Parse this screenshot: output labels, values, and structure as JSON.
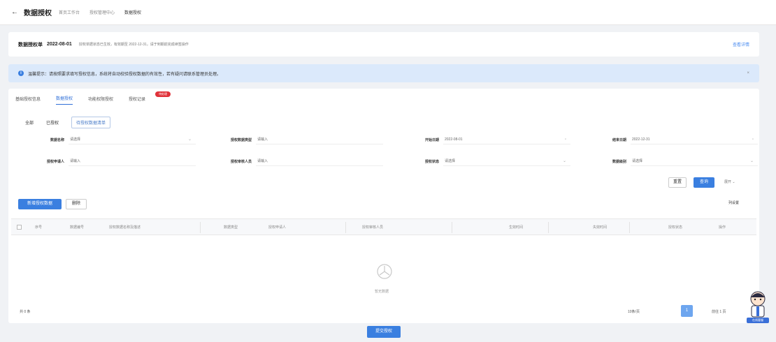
{
  "header": {
    "back_icon": "arrow-left-icon",
    "title": "数据授权",
    "breadcrumbs": [
      "首页工作台",
      "授权管理中心",
      "数据授权"
    ]
  },
  "info": {
    "label": "数据授权单",
    "date": "2022-08-01",
    "desc": "授权单据状态已生效，有效期至 2022-12-31，请于到期前完成续签操作",
    "link": "查看详情"
  },
  "notice": {
    "icon": "info-icon",
    "text": "温馨提示：请按照要求填写授权信息，系统将自动校验授权数据的有效性，若有疑问请联系管理员处理。",
    "close": "×"
  },
  "tabs": [
    {
      "label": "基础授权信息"
    },
    {
      "label": "数据授权"
    },
    {
      "label": "功能权限授权"
    },
    {
      "label": "授权记录"
    }
  ],
  "tab_badge": "待处理",
  "subtabs": [
    "全部",
    "已授权",
    "待授权数据清单"
  ],
  "filters_row1": [
    {
      "label": "数据名称",
      "value": "请选择",
      "icon": "chevron-down-icon"
    },
    {
      "label": "授权数据类型",
      "value": "请输入",
      "icon": ""
    },
    {
      "label": "开始日期",
      "value": "2022-08-01",
      "icon": "calendar-icon"
    },
    {
      "label": "结束日期",
      "value": "2022-12-31",
      "icon": "calendar-icon"
    }
  ],
  "filters_row2": [
    {
      "label": "授权申请人",
      "value": "请输入",
      "icon": ""
    },
    {
      "label": "授权审核人员",
      "value": "请输入",
      "icon": ""
    },
    {
      "label": "授权状态",
      "value": "请选择",
      "icon": "chevron-down-icon"
    },
    {
      "label": "数据级别",
      "value": "请选择",
      "icon": "chevron-down-icon"
    }
  ],
  "buttons": {
    "reset": "重置",
    "search": "查询",
    "expand": "展开 ⌄",
    "add": "新增授权数据",
    "delete": "删除",
    "list_settings": "列设置",
    "confirm": "提交授权"
  },
  "table": {
    "columns": [
      "序号",
      "数据编号",
      "授权数据名称及描述",
      "数据类型",
      "授权申请人",
      "授权审核人员",
      "生效时间",
      "失效时间",
      "授权状态",
      "操作"
    ]
  },
  "empty_text": "暂无数据",
  "pagination": {
    "total": "共 0 条",
    "size": "10条/页",
    "current": "1",
    "goto": "前往 1 页"
  },
  "assistant_label": "在线客服"
}
